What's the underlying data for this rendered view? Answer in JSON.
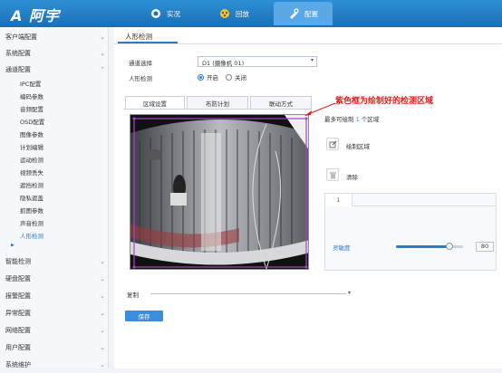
{
  "header": {
    "logo": "A 阿宇",
    "tabs": [
      {
        "label": "实况",
        "icon": "live-view-icon"
      },
      {
        "label": "回放",
        "icon": "playback-icon"
      },
      {
        "label": "配置",
        "icon": "config-icon",
        "active": true
      }
    ]
  },
  "sidebar": {
    "groups": [
      {
        "label": "客户端配置"
      },
      {
        "label": "系统配置"
      },
      {
        "label": "通道配置"
      },
      {
        "label": "智能检测"
      },
      {
        "label": "硬盘配置"
      },
      {
        "label": "报警配置"
      },
      {
        "label": "异常配置"
      },
      {
        "label": "网络配置"
      },
      {
        "label": "用户配置"
      },
      {
        "label": "系统维护"
      }
    ],
    "channel_items": [
      "IPC配置",
      "编码参数",
      "音频配置",
      "OSD配置",
      "图像参数",
      "计划编辑",
      "运动检测",
      "视频丢失",
      "遮挡检测",
      "隐私遮盖",
      "抓图参数",
      "声音检测",
      "人形检测"
    ]
  },
  "main": {
    "title": "人形检测",
    "channel_label": "通道选择",
    "channel_value": "D1 (摄像机 01)",
    "detect_label": "人形检测",
    "radio_on": "开启",
    "radio_off": "关闭",
    "subtabs": [
      "区域设置",
      "布防计划",
      "联动方式"
    ],
    "annotation": "紫色框为绘制好的检测区域",
    "max_regions_prefix": "最多可绘制",
    "max_regions_num": "1",
    "max_regions_suffix": "个区域",
    "draw_region": "绘制区域",
    "clear": "清除",
    "region_tab": "1",
    "sensitivity_label": "灵敏度",
    "sensitivity_value": "80",
    "sensitivity_fraction": 0.8,
    "copy_label": "复制",
    "save_label": "保存",
    "accent": "#2a7cc7",
    "annotation_color": "#e02020",
    "region_color": "#b040d0"
  }
}
